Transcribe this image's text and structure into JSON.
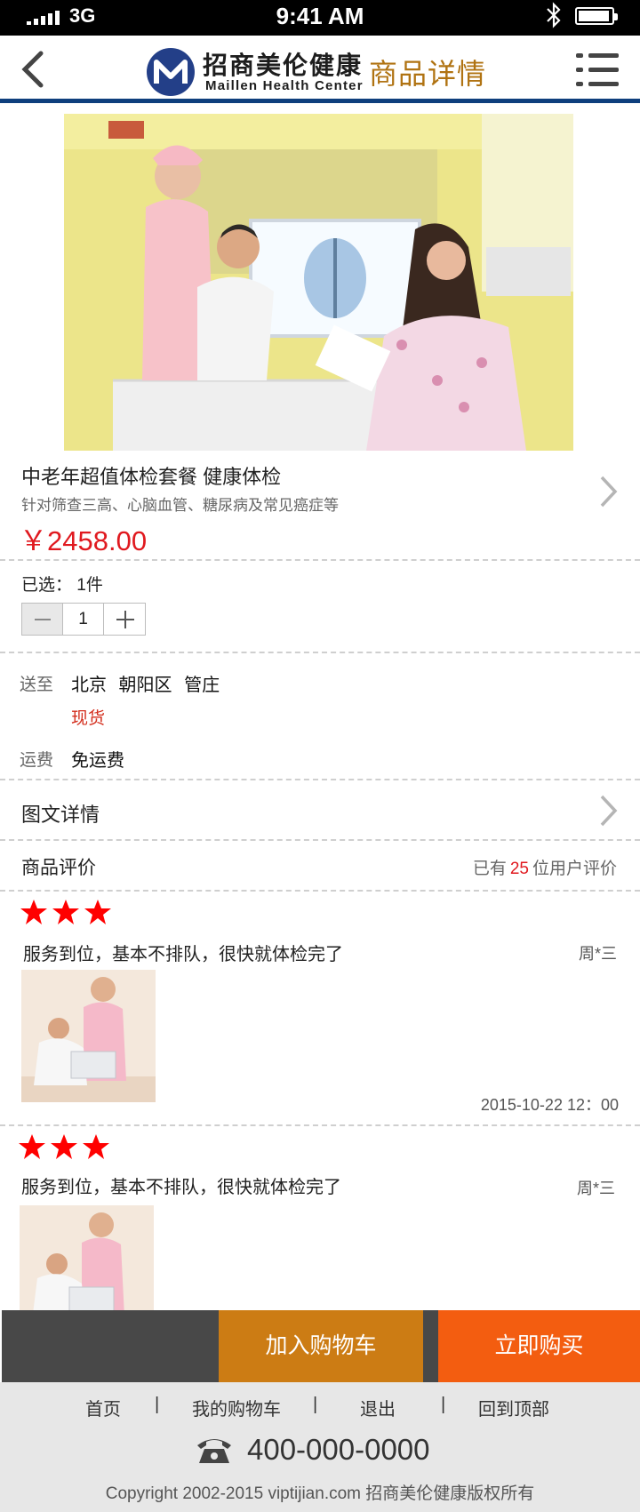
{
  "status_bar": {
    "carrier": "3G",
    "time": "9:41 AM"
  },
  "header": {
    "brand_cn": "招商美伦健康",
    "brand_en": "Maillen Health Center",
    "title": "商品详情"
  },
  "product": {
    "name": "中老年超值体检套餐 健康体检",
    "description": "针对筛查三高、心脑血管、糖尿病及常见癌症等",
    "price": "￥2458.00"
  },
  "quantity": {
    "selected_label": "已选： 1件",
    "value": "1"
  },
  "shipping": {
    "to_label": "送至",
    "address": "北京 朝阳区 管庄",
    "stock": "现货",
    "fee_label": "运费",
    "fee_value": "免运费"
  },
  "detail_link": "图文详情",
  "reviews_header": {
    "title": "商品评价",
    "count_prefix": "已有",
    "count": "25",
    "count_suffix": "位用户评价"
  },
  "reviews": [
    {
      "rating": 3,
      "comment": "服务到位，基本不排队，很快就体检完了",
      "author": "周*三",
      "date": "2015-10-22 12：00"
    },
    {
      "rating": 3,
      "comment": "服务到位，基本不排队，很快就体检完了",
      "author": "周*三"
    }
  ],
  "actions": {
    "add_to_cart": "加入购物车",
    "buy_now": "立即购买"
  },
  "footer": {
    "nav": [
      "首页",
      "我的购物车",
      "退出",
      "回到顶部"
    ],
    "separator": "|",
    "phone": "400-000-0000",
    "copyright": "Copyright 2002-2015 viptijian.com  招商美伦健康版权所有"
  },
  "colors": {
    "brand_navy": "#0e3f7d",
    "title_gold": "#b07312",
    "price_red": "#e0191f",
    "cart_orange": "#cc7c14",
    "buy_orange": "#f35d10",
    "star_red": "#ff0000"
  }
}
